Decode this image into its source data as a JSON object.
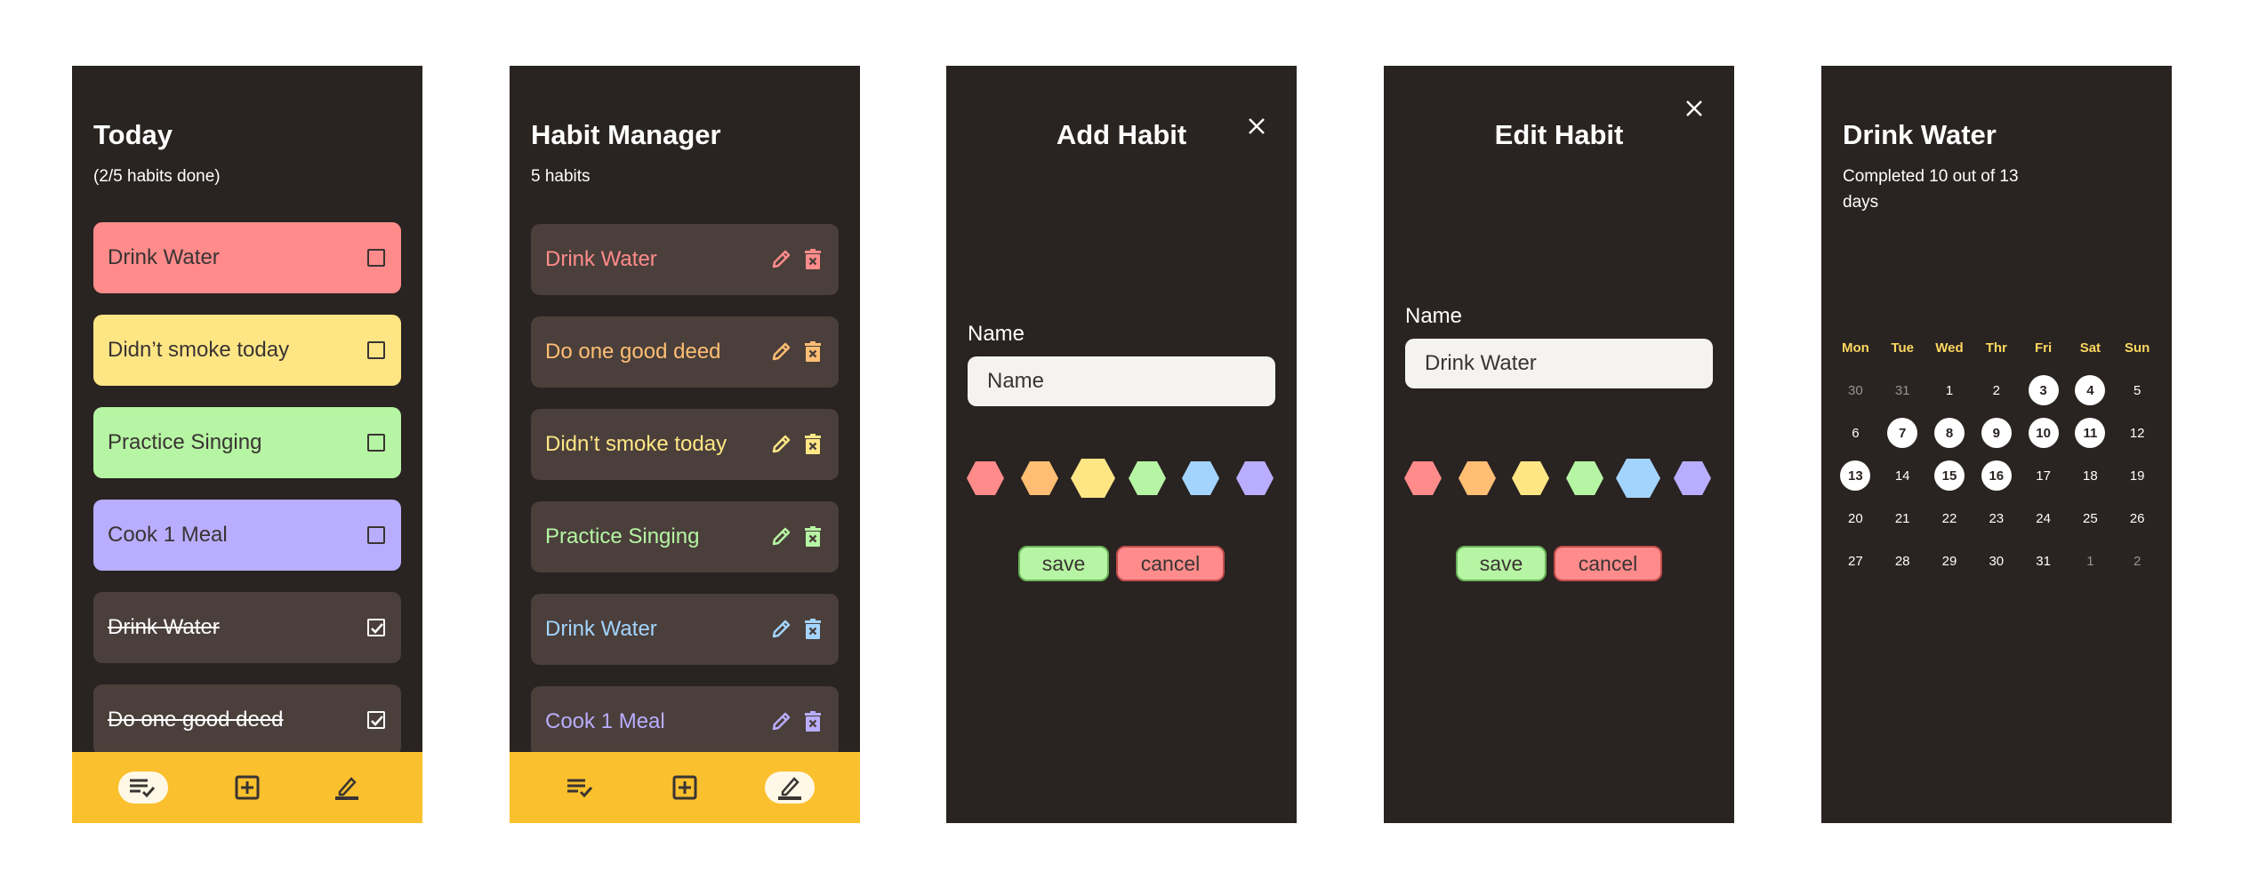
{
  "colors": {
    "background": "#292321",
    "card": "#4a3f3b",
    "nav": "#fbc02d",
    "red": "#ff8b8b",
    "orange": "#ffbe73",
    "yellow": "#ffe685",
    "green": "#b6f5a3",
    "blue": "#a3d4ff",
    "purple": "#b9adff"
  },
  "today": {
    "title": "Today",
    "subtitle": "(2/5 habits done)",
    "habits": [
      {
        "label": "Drink Water",
        "color": "red",
        "done": false
      },
      {
        "label": "Didn’t smoke today",
        "color": "yellow",
        "done": false
      },
      {
        "label": "Practice Singing",
        "color": "green",
        "done": false
      },
      {
        "label": "Cook 1 Meal",
        "color": "purple",
        "done": false
      },
      {
        "label": "Drink Water",
        "color": "card",
        "done": true
      },
      {
        "label": "Do one good deed",
        "color": "card",
        "done": true
      }
    ]
  },
  "manager": {
    "title": "Habit Manager",
    "subtitle": "5 habits",
    "habits": [
      {
        "label": "Drink Water",
        "color": "red"
      },
      {
        "label": "Do one good deed",
        "color": "orange"
      },
      {
        "label": "Didn’t smoke today",
        "color": "yellow"
      },
      {
        "label": "Practice Singing",
        "color": "green"
      },
      {
        "label": "Drink Water",
        "color": "blue"
      },
      {
        "label": "Cook 1 Meal",
        "color": "purple"
      }
    ]
  },
  "nav": {
    "icons": [
      "checklist-icon",
      "add-box-icon",
      "edit-icon"
    ]
  },
  "add": {
    "title": "Add Habit",
    "name_label": "Name",
    "name_placeholder": "Name",
    "name_value": "",
    "save_label": "save",
    "cancel_label": "cancel",
    "selected_color": "yellow"
  },
  "edit": {
    "title": "Edit Habit",
    "name_label": "Name",
    "name_value": "Drink Water",
    "save_label": "save",
    "cancel_label": "cancel",
    "selected_color": "blue"
  },
  "swatches": [
    "red",
    "orange",
    "yellow",
    "green",
    "blue",
    "purple"
  ],
  "detail": {
    "title": "Drink Water",
    "subtitle": "Completed 10 out of 13 days",
    "weekdays": [
      "Mon",
      "Tue",
      "Wed",
      "Thr",
      "Fri",
      "Sat",
      "Sun"
    ],
    "weeks": [
      [
        {
          "d": "30",
          "s": "other"
        },
        {
          "d": "31",
          "s": "other"
        },
        {
          "d": "1",
          "s": ""
        },
        {
          "d": "2",
          "s": ""
        },
        {
          "d": "3",
          "s": "done"
        },
        {
          "d": "4",
          "s": "done"
        },
        {
          "d": "5",
          "s": ""
        }
      ],
      [
        {
          "d": "6",
          "s": ""
        },
        {
          "d": "7",
          "s": "done"
        },
        {
          "d": "8",
          "s": "done"
        },
        {
          "d": "9",
          "s": "done"
        },
        {
          "d": "10",
          "s": "done"
        },
        {
          "d": "11",
          "s": "done"
        },
        {
          "d": "12",
          "s": ""
        }
      ],
      [
        {
          "d": "13",
          "s": "done"
        },
        {
          "d": "14",
          "s": ""
        },
        {
          "d": "15",
          "s": "done"
        },
        {
          "d": "16",
          "s": "done"
        },
        {
          "d": "17",
          "s": ""
        },
        {
          "d": "18",
          "s": ""
        },
        {
          "d": "19",
          "s": ""
        }
      ],
      [
        {
          "d": "20",
          "s": ""
        },
        {
          "d": "21",
          "s": ""
        },
        {
          "d": "22",
          "s": ""
        },
        {
          "d": "23",
          "s": ""
        },
        {
          "d": "24",
          "s": ""
        },
        {
          "d": "25",
          "s": ""
        },
        {
          "d": "26",
          "s": ""
        }
      ],
      [
        {
          "d": "27",
          "s": ""
        },
        {
          "d": "28",
          "s": ""
        },
        {
          "d": "29",
          "s": ""
        },
        {
          "d": "30",
          "s": ""
        },
        {
          "d": "31",
          "s": ""
        },
        {
          "d": "1",
          "s": "other"
        },
        {
          "d": "2",
          "s": "other"
        }
      ]
    ]
  }
}
